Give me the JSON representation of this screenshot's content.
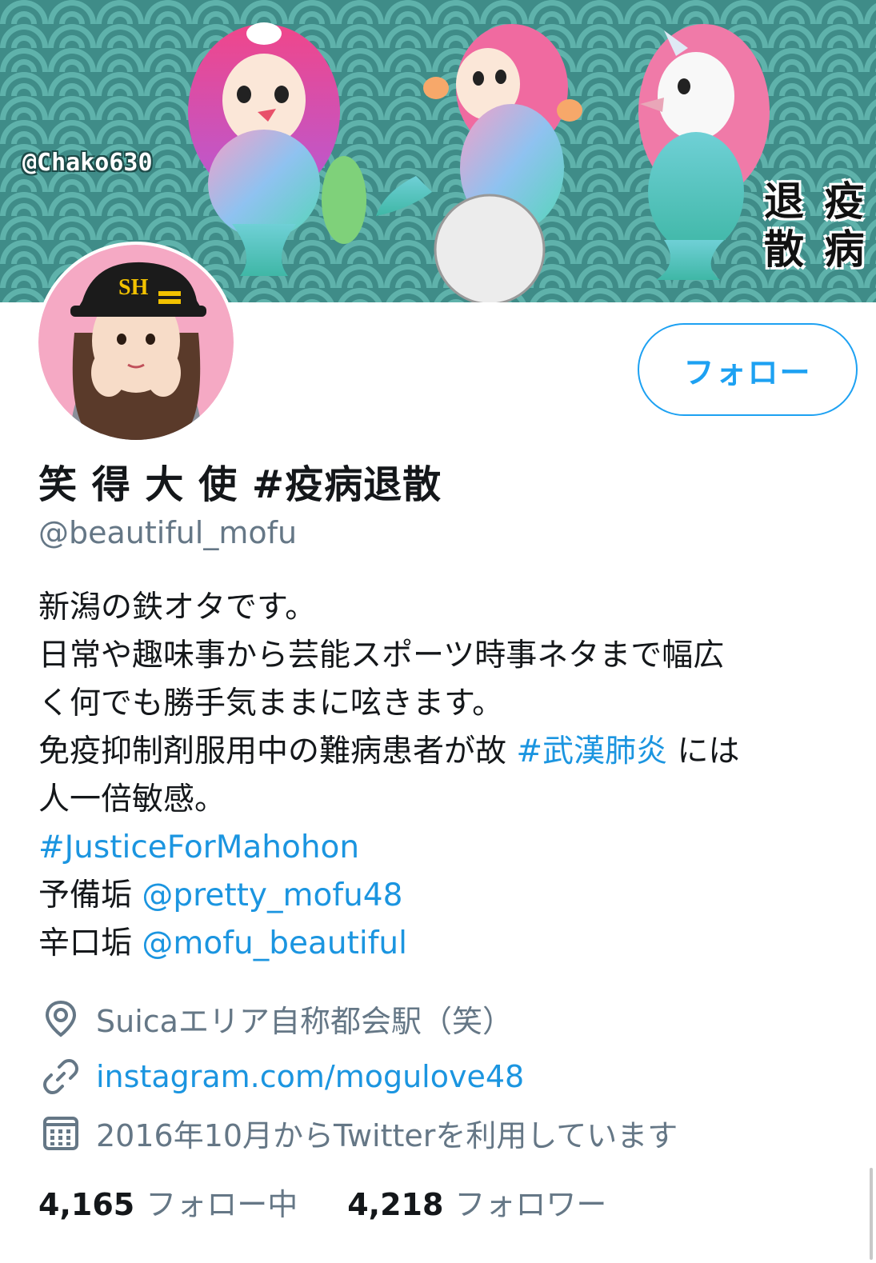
{
  "banner": {
    "watermark": "@Chako630",
    "caption_line1": "退 疫",
    "caption_line2": "散 病"
  },
  "profile": {
    "display_name": "笑 得 大 使 #疫病退散",
    "handle": "@beautiful_mofu",
    "follow_button_label": "フォロー"
  },
  "bio": {
    "line1": "新潟の鉄オタです。",
    "line2": "日常や趣味事から芸能スポーツ時事ネタまで幅広",
    "line3": "く何でも勝手気ままに呟きます。",
    "line4_text": "免疫抑制剤服用中の難病患者が故 ",
    "line4_hashtag": "#武漢肺炎",
    "line4_tail": " には",
    "line5": "人一倍敏感。",
    "hashtag_justice": "#JusticeForMahohon",
    "spare_label": "予備垢 ",
    "spare_mention": "@pretty_mofu48",
    "spicy_label": "辛口垢 ",
    "spicy_mention": "@mofu_beautiful"
  },
  "meta": {
    "location": "Suicaエリア自称都会駅（笑）",
    "url": "instagram.com/mogulove48",
    "joined": "2016年10月からTwitterを利用しています"
  },
  "stats": {
    "following_count": "4,165",
    "following_label": "フォロー中",
    "followers_count": "4,218",
    "followers_label": "フォロワー"
  },
  "colors": {
    "accent": "#1da1f2",
    "link": "#1b95e0",
    "muted": "#657786",
    "text": "#14171a"
  },
  "icons": {
    "location": "location-pin-icon",
    "url": "link-icon",
    "joined": "calendar-icon"
  }
}
